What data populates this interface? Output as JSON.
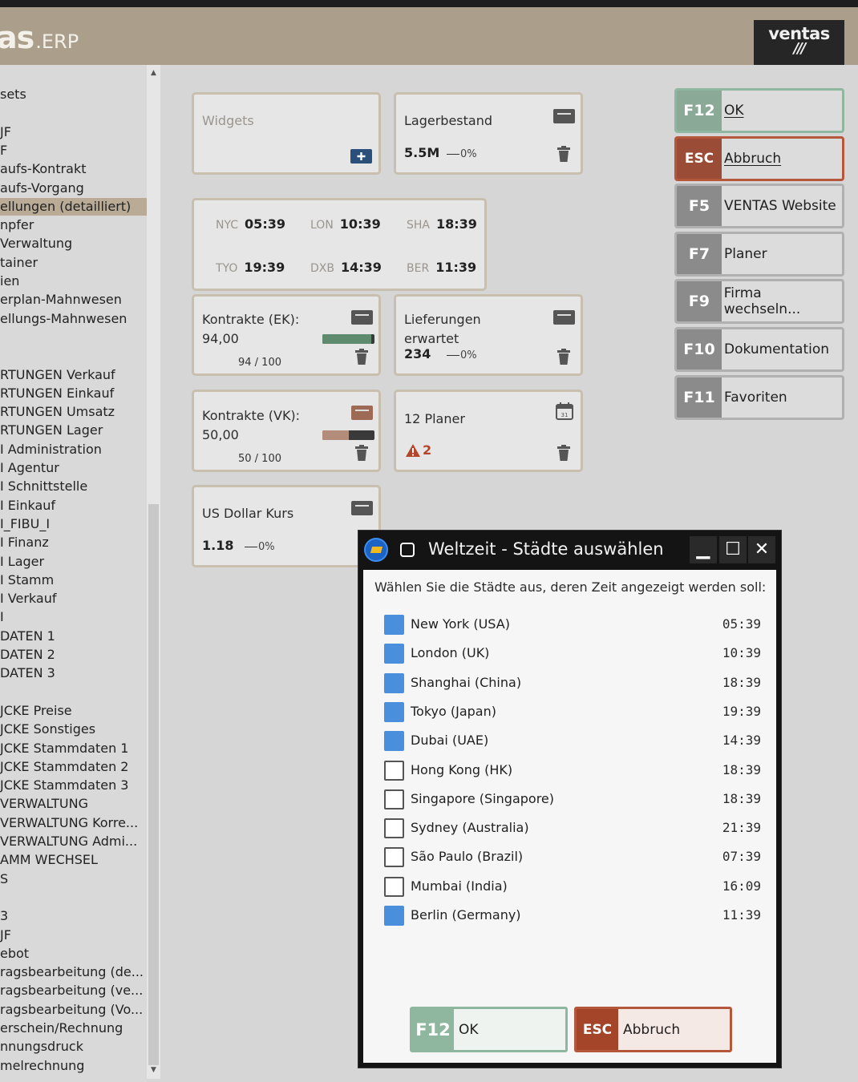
{
  "header": {
    "brand_main": "as",
    "brand_sub": ".ERP",
    "logo_top": "ventas",
    "logo_bottom": "///"
  },
  "sidebar": {
    "items": [
      "sets",
      "",
      "JF",
      "F",
      "aufs-Kontrakt",
      "aufs-Vorgang",
      "ellungen (detailliert)",
      "npfer",
      "Verwaltung",
      "tainer",
      "ien",
      "erplan-Mahnwesen",
      "ellungs-Mahnwesen",
      "",
      "",
      "RTUNGEN Verkauf",
      "RTUNGEN Einkauf",
      "RTUNGEN Umsatz",
      "RTUNGEN Lager",
      "I Administration",
      "I Agentur",
      "I Schnittstelle",
      "I Einkauf",
      "I_FIBU_I",
      "I Finanz",
      "I Lager",
      "I Stamm",
      "I Verkauf",
      "I",
      "DATEN 1",
      "DATEN 2",
      "DATEN 3",
      "",
      "JCKE Preise",
      "JCKE Sonstiges",
      "JCKE Stammdaten 1",
      "JCKE Stammdaten 2",
      "JCKE Stammdaten 3",
      "VERWALTUNG",
      "VERWALTUNG Korre...",
      "VERWALTUNG Admi...",
      "AMM WECHSEL",
      "S",
      "",
      "3",
      "JF",
      "ebot",
      "ragsbearbeitung (de...",
      "ragsbearbeitung (ve...",
      "ragsbearbeitung (Vo...",
      "erschein/Rechnung",
      "nnungsdruck",
      "melrechnung"
    ],
    "selected_index": 6
  },
  "widgets": {
    "widgets_tile": {
      "title": "Widgets"
    },
    "lagerbestand": {
      "title": "Lagerbestand",
      "value": "5.5M",
      "change": "0%"
    },
    "clocks": [
      {
        "code": "NYC",
        "time": "05:39"
      },
      {
        "code": "LON",
        "time": "10:39"
      },
      {
        "code": "SHA",
        "time": "18:39"
      },
      {
        "code": "TYO",
        "time": "19:39"
      },
      {
        "code": "DXB",
        "time": "14:39"
      },
      {
        "code": "BER",
        "time": "11:39"
      }
    ],
    "kontrakte_ek": {
      "title": "Kontrakte (EK):",
      "value": "94,00",
      "progress_text": "94 / 100",
      "progress": 0.94,
      "color": "#5e8a6e"
    },
    "lieferungen": {
      "title_line1": "Lieferungen",
      "title_line2": "erwartet",
      "value": "234",
      "change": "0%"
    },
    "kontrakte_vk": {
      "title": "Kontrakte (VK):",
      "value": "50,00",
      "progress_text": "50 / 100",
      "progress": 0.5,
      "color": "#b48c7a"
    },
    "planer": {
      "title": "12 Planer",
      "warning_count": "2"
    },
    "usd": {
      "title": "US Dollar Kurs",
      "value": "1.18",
      "change": "0%"
    }
  },
  "fkeys": [
    {
      "key": "F12",
      "label": "OK",
      "style": "ok"
    },
    {
      "key": "ESC",
      "label": "Abbruch",
      "style": "esc"
    },
    {
      "key": "F5",
      "label": "VENTAS Website",
      "style": "plain"
    },
    {
      "key": "F7",
      "label": "Planer",
      "style": "plain"
    },
    {
      "key": "F9",
      "label": "Firma wechseln...",
      "style": "plain"
    },
    {
      "key": "F10",
      "label": "Dokumentation",
      "style": "plain"
    },
    {
      "key": "F11",
      "label": "Favoriten",
      "style": "plain"
    }
  ],
  "dialog": {
    "title": "Weltzeit - Städte auswählen",
    "prompt": "Wählen Sie die Städte aus, deren Zeit angezeigt werden soll:",
    "cities": [
      {
        "name": "New York (USA)",
        "time": "05:39",
        "checked": true
      },
      {
        "name": "London (UK)",
        "time": "10:39",
        "checked": true
      },
      {
        "name": "Shanghai (China)",
        "time": "18:39",
        "checked": true
      },
      {
        "name": "Tokyo (Japan)",
        "time": "19:39",
        "checked": true
      },
      {
        "name": "Dubai (UAE)",
        "time": "14:39",
        "checked": true
      },
      {
        "name": "Hong Kong (HK)",
        "time": "18:39",
        "checked": false
      },
      {
        "name": "Singapore (Singapore)",
        "time": "18:39",
        "checked": false
      },
      {
        "name": "Sydney (Australia)",
        "time": "21:39",
        "checked": false
      },
      {
        "name": "São Paulo (Brazil)",
        "time": "07:39",
        "checked": false
      },
      {
        "name": "Mumbai (India)",
        "time": "16:09",
        "checked": false
      },
      {
        "name": "Berlin (Germany)",
        "time": "11:39",
        "checked": true
      }
    ],
    "ok_key": "F12",
    "ok_label": "OK",
    "cancel_key": "ESC",
    "cancel_label": "Abbruch"
  }
}
